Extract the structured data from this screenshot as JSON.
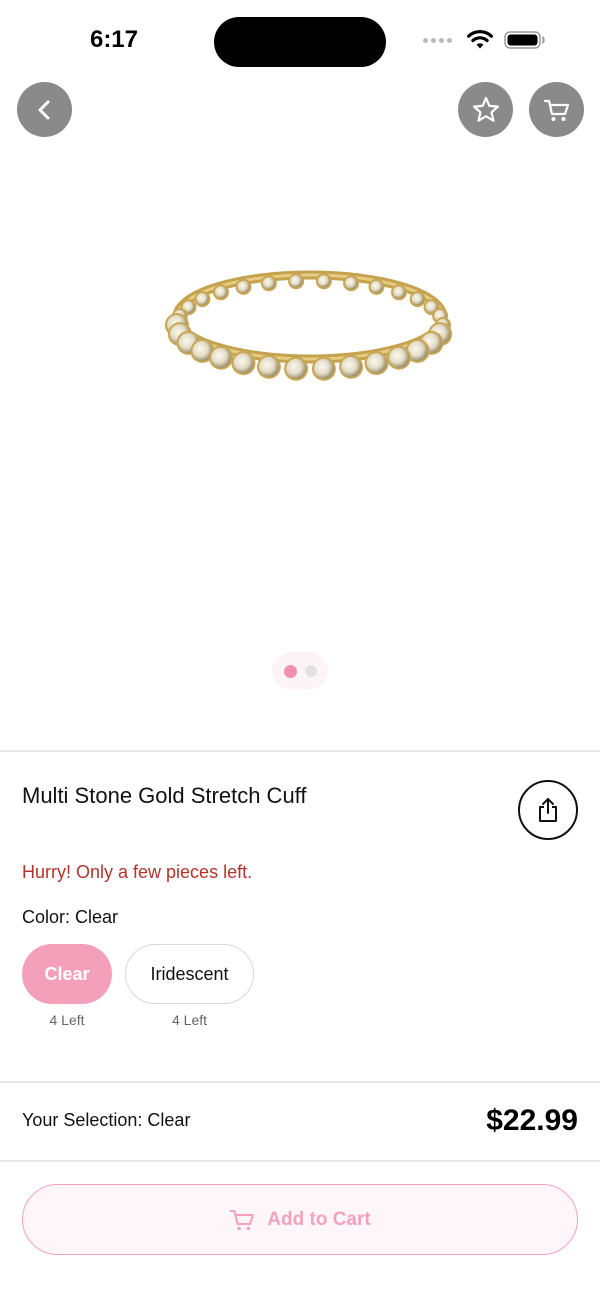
{
  "status_bar": {
    "time": "6:17"
  },
  "nav": {
    "back_icon": "chevron-left-icon",
    "favorite_icon": "star-icon",
    "cart_icon": "cart-icon"
  },
  "gallery": {
    "page_count": 2,
    "active_page": 1
  },
  "product": {
    "title": "Multi Stone Gold Stretch Cuff",
    "urgency_text": "Hurry! Only a few pieces left.",
    "color_label": "Color: Clear",
    "options": [
      {
        "label": "Clear",
        "stock": "4 Left",
        "selected": true
      },
      {
        "label": "Iridescent",
        "stock": "4 Left",
        "selected": false
      }
    ]
  },
  "selection": {
    "label": "Your Selection: Clear",
    "price": "$22.99"
  },
  "add_to_cart": {
    "label": "Add to Cart"
  },
  "colors": {
    "accent_pink": "#f5a0bb",
    "urgency_red": "#b2342a",
    "nav_button_gray": "#8a8a8a"
  }
}
